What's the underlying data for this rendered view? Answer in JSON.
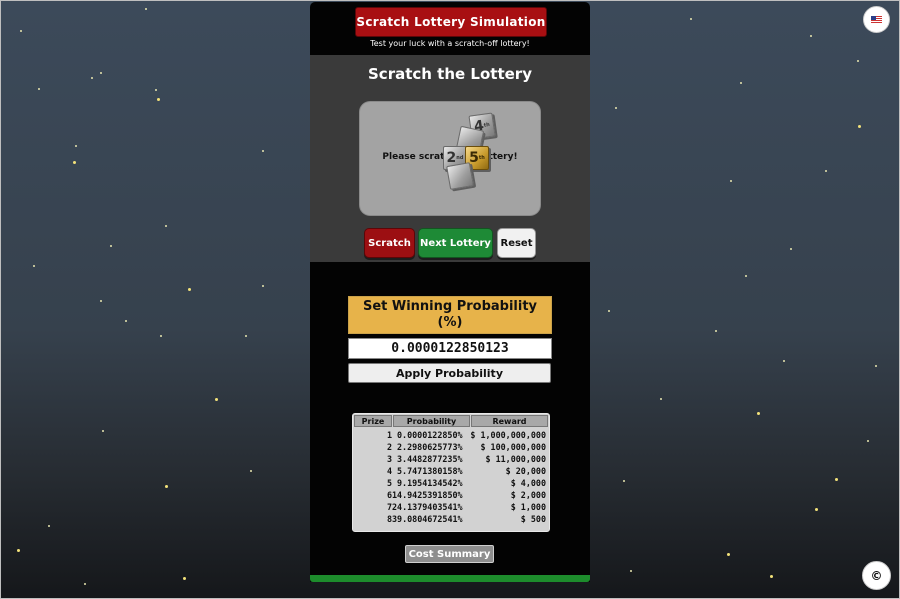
{
  "header": {
    "title": "Scratch Lottery Simulation",
    "subtitle": "Test your luck with a scratch-off lottery!"
  },
  "scratch": {
    "heading": "Scratch the Lottery",
    "card_message": "Please scratch the lottery!",
    "cubes": [
      {
        "label": "4",
        "suffix": "th"
      },
      {
        "label": "2",
        "suffix": "nd"
      },
      {
        "label": "5",
        "suffix": "th"
      }
    ]
  },
  "buttons": {
    "scratch": "Scratch",
    "next": "Next Lottery",
    "reset": "Reset"
  },
  "probability": {
    "heading": "Set Winning Probability (%)",
    "value": "0.0000122850123",
    "apply": "Apply Probability"
  },
  "table": {
    "headers": [
      "Prize",
      "Probability",
      "Reward"
    ],
    "rows": [
      {
        "prize": "1",
        "probability": "0.0000122850%",
        "reward": "$ 1,000,000,000"
      },
      {
        "prize": "2",
        "probability": "2.2980625773%",
        "reward": "$ 100,000,000"
      },
      {
        "prize": "3",
        "probability": "3.4482877235%",
        "reward": "$ 11,000,000"
      },
      {
        "prize": "4",
        "probability": "5.7471380158%",
        "reward": "$ 20,000"
      },
      {
        "prize": "5",
        "probability": "9.1954134542%",
        "reward": "$ 4,000"
      },
      {
        "prize": "6",
        "probability": "14.9425391850%",
        "reward": "$ 2,000"
      },
      {
        "prize": "7",
        "probability": "24.1379403541%",
        "reward": "$ 1,000"
      },
      {
        "prize": "8",
        "probability": "39.0804672541%",
        "reward": "$ 500"
      }
    ]
  },
  "footer": {
    "cost_summary": "Cost Summary",
    "progress_fraction": 1.0
  },
  "icons": {
    "language": "us-flag-icon",
    "copyright": "copyright-icon"
  },
  "copyright_symbol": "©"
}
